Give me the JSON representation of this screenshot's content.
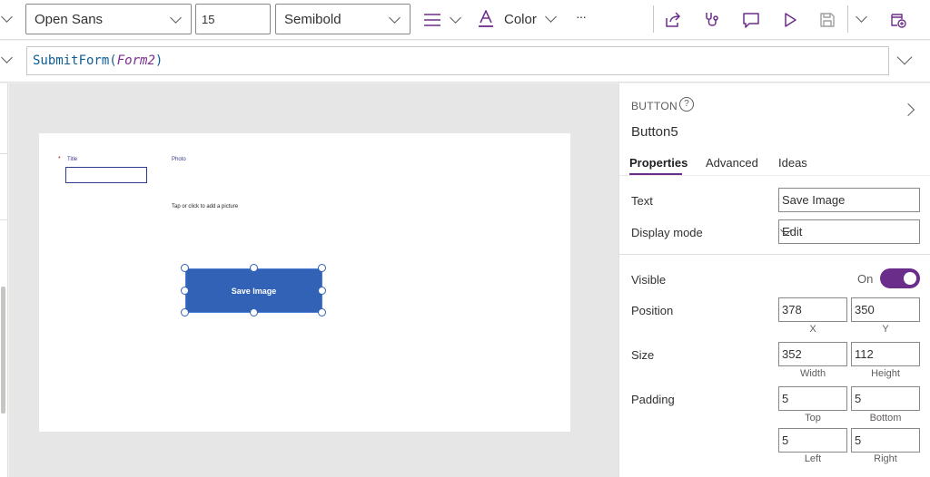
{
  "toolbar": {
    "font_family": "Open Sans",
    "font_size": "15",
    "font_weight": "Semibold",
    "color_label": "Color",
    "more_label": "···"
  },
  "formula": {
    "function_name": "SubmitForm",
    "open_paren": "(",
    "argument": "Form2",
    "close_paren": ")"
  },
  "canvas": {
    "title_required": "*",
    "title_label": "Title",
    "photo_label": "Photo",
    "photo_hint": "Tap or click to add a picture",
    "button_text": "Save Image"
  },
  "panel": {
    "control_type": "BUTTON",
    "help_glyph": "?",
    "control_name": "Button5",
    "tabs": [
      "Properties",
      "Advanced",
      "Ideas"
    ],
    "text_label": "Text",
    "text_value": "Save Image",
    "display_mode_label": "Display mode",
    "display_mode_value": "Edit",
    "visible_label": "Visible",
    "visible_state": "On",
    "position_label": "Position",
    "position_x": "378",
    "position_y": "350",
    "x_label": "X",
    "y_label": "Y",
    "size_label": "Size",
    "size_width": "352",
    "size_height": "112",
    "width_label": "Width",
    "height_label": "Height",
    "padding_label": "Padding",
    "padding_top": "5",
    "padding_bottom": "5",
    "padding_left": "5",
    "padding_right": "5",
    "top_label": "Top",
    "bottom_label": "Bottom",
    "left_label": "Left",
    "right_label": "Right"
  },
  "colors": {
    "accent": "#6b2d8a",
    "button_fill": "#3162b6",
    "formula_function": "#0f5e97",
    "formula_argument": "#7b2e91"
  },
  "icons": [
    "chevron-down-icon",
    "align-icon",
    "font-color-icon",
    "share-icon",
    "app-checker-icon",
    "comments-icon",
    "play-icon",
    "save-icon",
    "publish-icon",
    "help-icon",
    "chevron-right-icon"
  ]
}
